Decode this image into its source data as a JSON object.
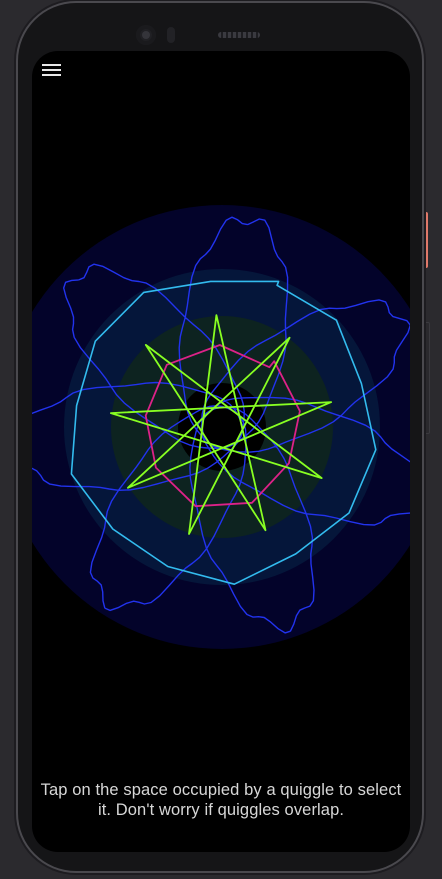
{
  "menu": {
    "icon": "hamburger-menu-icon"
  },
  "canvas": {
    "background": "#000000",
    "quiggles": [
      {
        "name": "blue-loops",
        "color": "#2233ee",
        "glow": "#0a0a55"
      },
      {
        "name": "cyan-polygon",
        "color": "#33bbee",
        "glow": "#06204a"
      },
      {
        "name": "green-star",
        "color": "#88ff22",
        "glow": "#0e2a1e"
      },
      {
        "name": "magenta-polygon",
        "color": "#dd2288",
        "glow": "#000000"
      }
    ]
  },
  "hint": {
    "line1": "Tap on the space occupied by a quiggle to select",
    "line2": "it. Don't worry if quiggles overlap."
  }
}
